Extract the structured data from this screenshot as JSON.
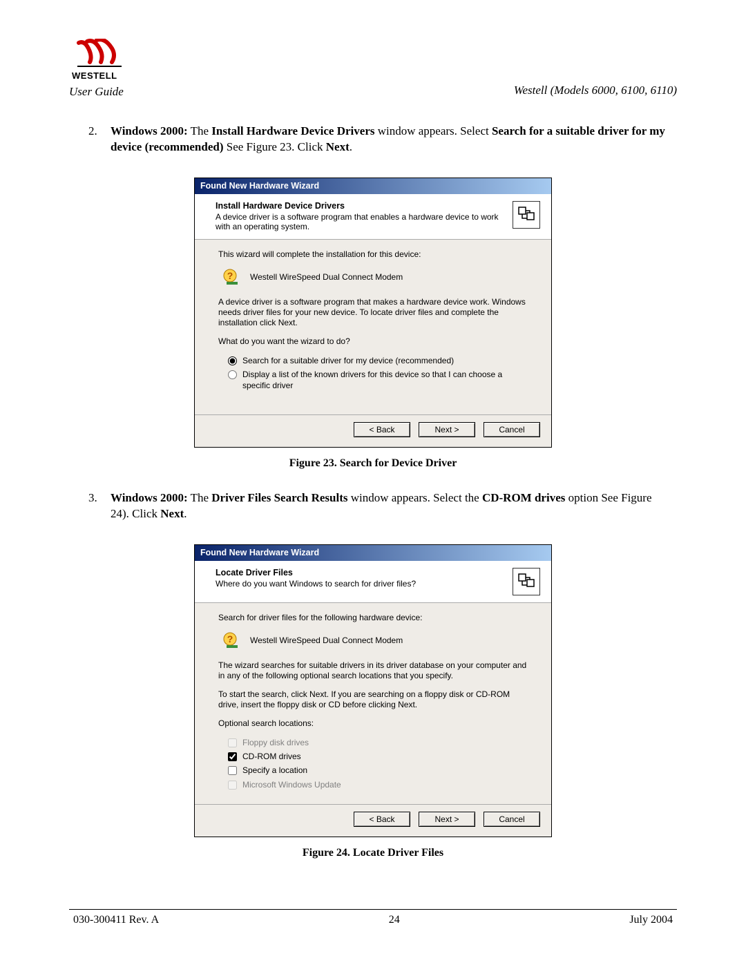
{
  "header": {
    "logo_name": "WESTELL",
    "guide_title": "User Guide",
    "model_line": "Westell (Models 6000, 6100, 6110)"
  },
  "step2": {
    "num": "2.",
    "prefix_bold": "Windows 2000:",
    "text_a": " The ",
    "bold_b": "Install Hardware Device Drivers",
    "text_c": " window appears. Select ",
    "bold_d": "Search for a suitable driver for my device (recommended)",
    "text_e": " See Figure 23. Click ",
    "bold_f": "Next",
    "text_g": "."
  },
  "dialog1": {
    "title": "Found New Hardware Wizard",
    "head_title": "Install Hardware Device Drivers",
    "head_sub": "A device driver is a software program that enables a hardware device to work with an operating system.",
    "line1": "This wizard will complete the installation for this device:",
    "device": "Westell WireSpeed Dual Connect Modem",
    "para2": "A device driver is a software program that makes a hardware device work. Windows needs driver files for your new device. To locate driver files and complete the installation click Next.",
    "question": "What do you want the wizard to do?",
    "opt1": "Search for a suitable driver for my device (recommended)",
    "opt2": "Display a list of the known drivers for this device so that I can choose a specific driver",
    "back": "< Back",
    "next": "Next >",
    "cancel": "Cancel"
  },
  "caption1": "Figure 23.  Search for Device Driver",
  "step3": {
    "num": "3.",
    "prefix_bold": "Windows 2000:",
    "text_a": " The ",
    "bold_b": "Driver Files Search Results",
    "text_c": " window appears. Select the ",
    "bold_d": "CD-ROM drives",
    "text_e": " option See Figure 24). Click ",
    "bold_f": "Next",
    "text_g": "."
  },
  "dialog2": {
    "title": "Found New Hardware Wizard",
    "head_title": "Locate Driver Files",
    "head_sub": "Where do you want Windows to search for driver files?",
    "line1": "Search for driver files for the following hardware device:",
    "device": "Westell WireSpeed Dual Connect Modem",
    "para2": "The wizard searches for suitable drivers in its driver database on your computer and in any of the following optional search locations that you specify.",
    "para3": "To start the search, click Next. If you are searching on a floppy disk or CD-ROM drive, insert the floppy disk or CD before clicking Next.",
    "opt_label": "Optional search locations:",
    "chk1": "Floppy disk drives",
    "chk2": "CD-ROM drives",
    "chk3": "Specify a location",
    "chk4": "Microsoft Windows Update",
    "back": "< Back",
    "next": "Next >",
    "cancel": "Cancel"
  },
  "caption2": "Figure 24.  Locate Driver Files",
  "footer": {
    "left": "030-300411 Rev. A",
    "center": "24",
    "right": "July 2004"
  }
}
